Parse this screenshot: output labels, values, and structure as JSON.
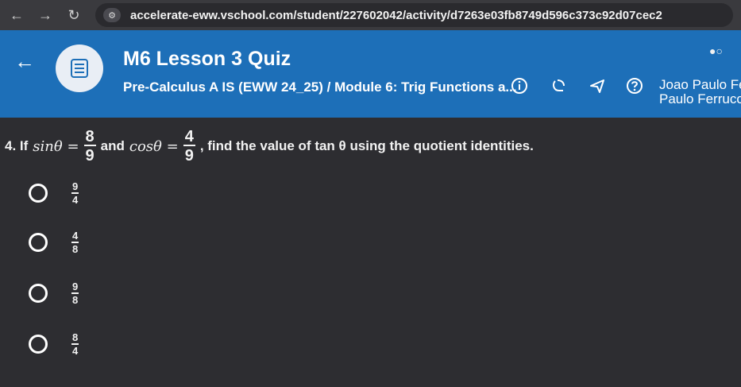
{
  "browser": {
    "back_icon": "arrow-left",
    "forward_icon": "arrow-right",
    "reload_icon": "reload",
    "url": "accelerate-eww.vschool.com/student/227602042/activity/d7263e03fb8749d596c373c92d07cec2"
  },
  "header": {
    "title": "M6 Lesson 3 Quiz",
    "course_path": "Pre-Calculus A IS (EWW 24_25) / Module 6: Trig Functions a...",
    "user_name_line1": "Joao Paulo Ferr",
    "user_name_line2": "Paulo Ferrucci S",
    "accent_color": "#1d6fb8"
  },
  "question": {
    "number_prefix": "4. If",
    "sin_expr": "sinθ =",
    "sin_num": "8",
    "sin_den": "9",
    "and_text": "and",
    "cos_expr": "cosθ =",
    "cos_num": "4",
    "cos_den": "9",
    "suffix_text": ", find the value of tan θ using the quotient identities."
  },
  "options": [
    {
      "num": "9",
      "den": "4"
    },
    {
      "num": "4",
      "den": "8"
    },
    {
      "num": "9",
      "den": "8"
    },
    {
      "num": "8",
      "den": "4"
    }
  ]
}
